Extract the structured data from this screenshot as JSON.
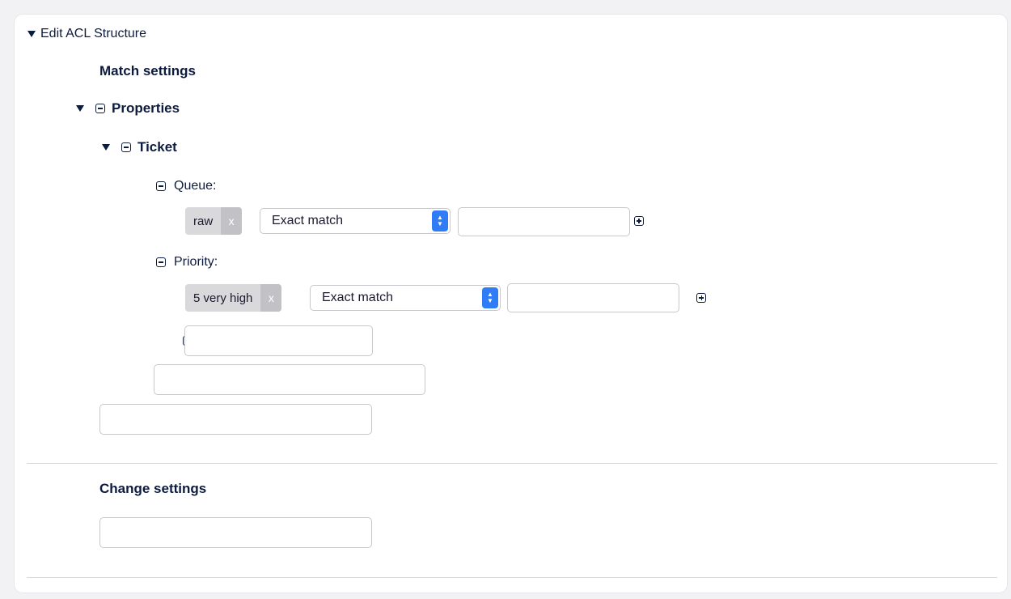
{
  "header": {
    "label": "Edit ACL Structure"
  },
  "match": {
    "title": "Match settings",
    "properties_label": "Properties",
    "ticket_label": "Ticket",
    "queue": {
      "label": "Queue:",
      "tag": "raw",
      "tag_remove": "x",
      "match_type": "Exact match",
      "value": ""
    },
    "priority": {
      "label": "Priority:",
      "tag": "5 very high",
      "tag_remove": "x",
      "match_type": "Exact match",
      "value": ""
    },
    "new_ticket_field": "",
    "new_properties_field": "",
    "new_match_field": ""
  },
  "change": {
    "title": "Change settings",
    "new_change_field": ""
  },
  "colors": {
    "text": "#0d1b3e",
    "accent": "#2f7cf6",
    "tag_bg": "#d9d9dc"
  },
  "icons": [
    "triangle-down-icon",
    "collapse-minus-icon",
    "expand-plus-icon",
    "stepper-icon",
    "remove-x-icon"
  ]
}
